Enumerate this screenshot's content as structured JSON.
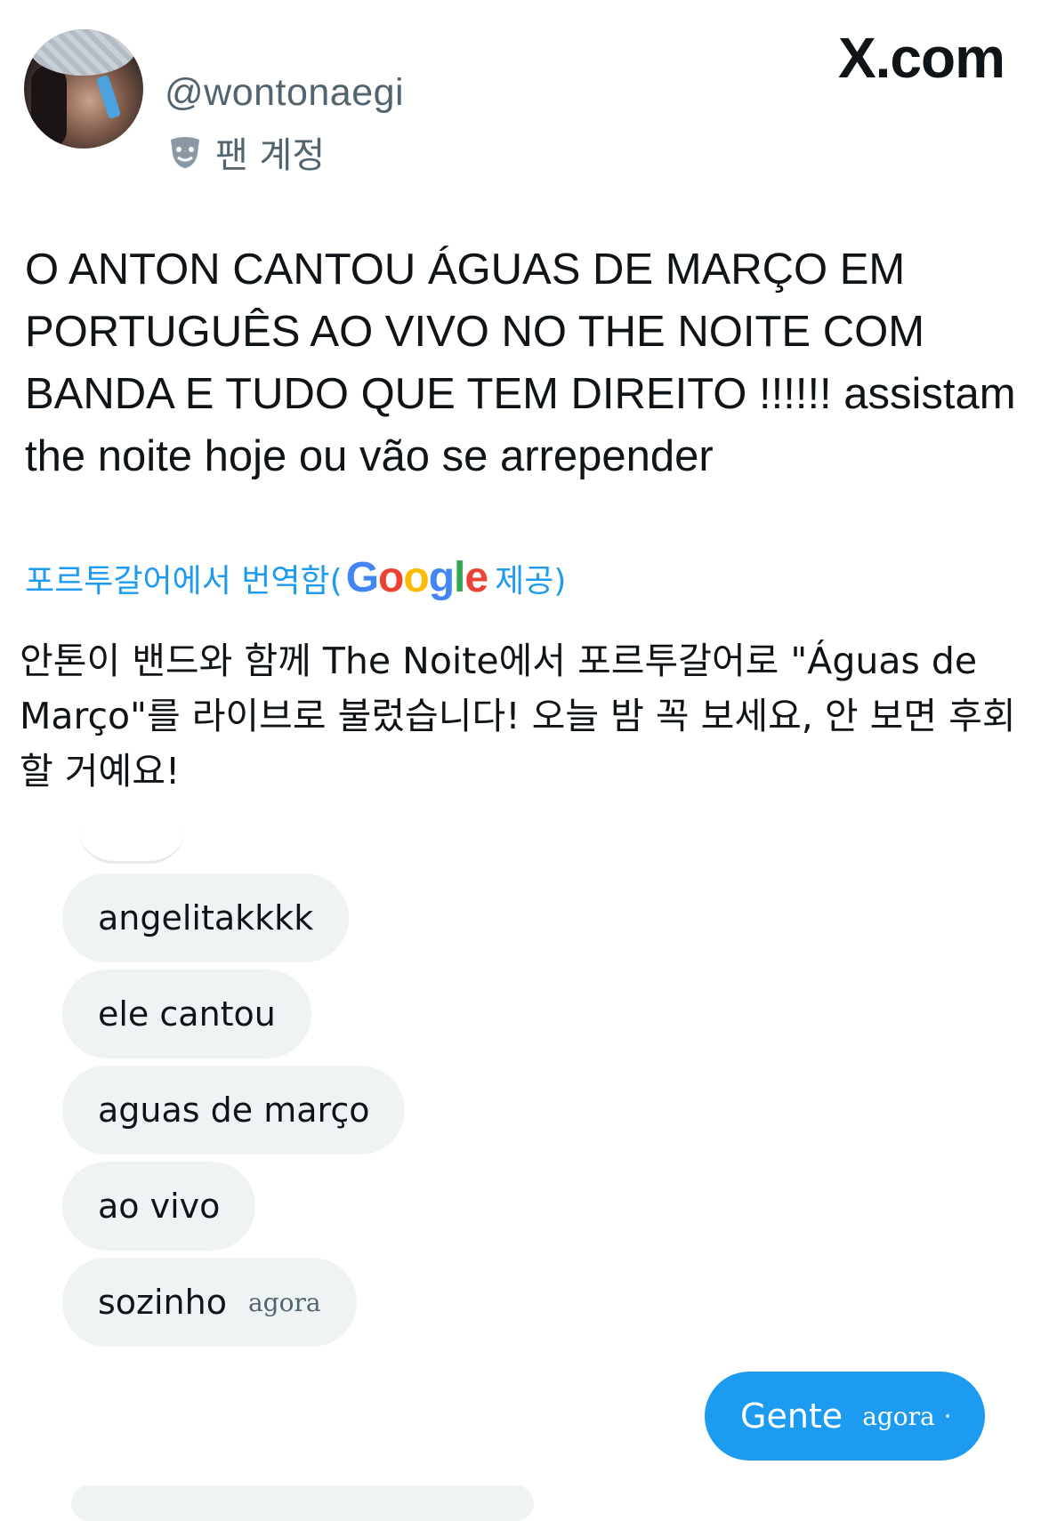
{
  "header": {
    "username": "@wontonaegi",
    "account_label": "팬 계정",
    "badge_icon": "theater-mask-icon",
    "site": "X.com"
  },
  "tweet": {
    "lines": [
      "O ANTON CANTOU ÁGUAS DE MARÇO EM",
      "PORTUGUÊS AO VIVO NO THE NOITE COM",
      "BANDA E TUDO QUE TEM DIREITO !!!!!! assistam",
      "the noite hoje ou vão se arrepender"
    ]
  },
  "translation": {
    "prefix": "포르투갈어에서 번역함(",
    "provider": "Google",
    "suffix": " 제공)",
    "lines": [
      "안톤이 밴드와 함께 The Noite에서 포르투갈어로 \"Águas de",
      "Março\"를 라이브로 불렀습니다! 오늘 밤 꼭 보세요, 안 보면 후회",
      "할 거예요!"
    ]
  },
  "chat": {
    "received": [
      {
        "text": "angelitakkkk",
        "time": ""
      },
      {
        "text": "ele cantou",
        "time": ""
      },
      {
        "text": "aguas de março",
        "time": ""
      },
      {
        "text": "ao vivo",
        "time": ""
      },
      {
        "text": "sozinho",
        "time": "agora"
      }
    ],
    "sent": {
      "text": "Gente",
      "time": "agora",
      "status_icon": "check-circle-icon"
    }
  },
  "colors": {
    "accent": "#1d9bf0",
    "bubble_bg": "#eff3f4",
    "muted_text": "#536471",
    "google_blue": "#4285F4",
    "google_red": "#EA4335",
    "google_yellow": "#FBBC05",
    "google_green": "#34A853"
  }
}
